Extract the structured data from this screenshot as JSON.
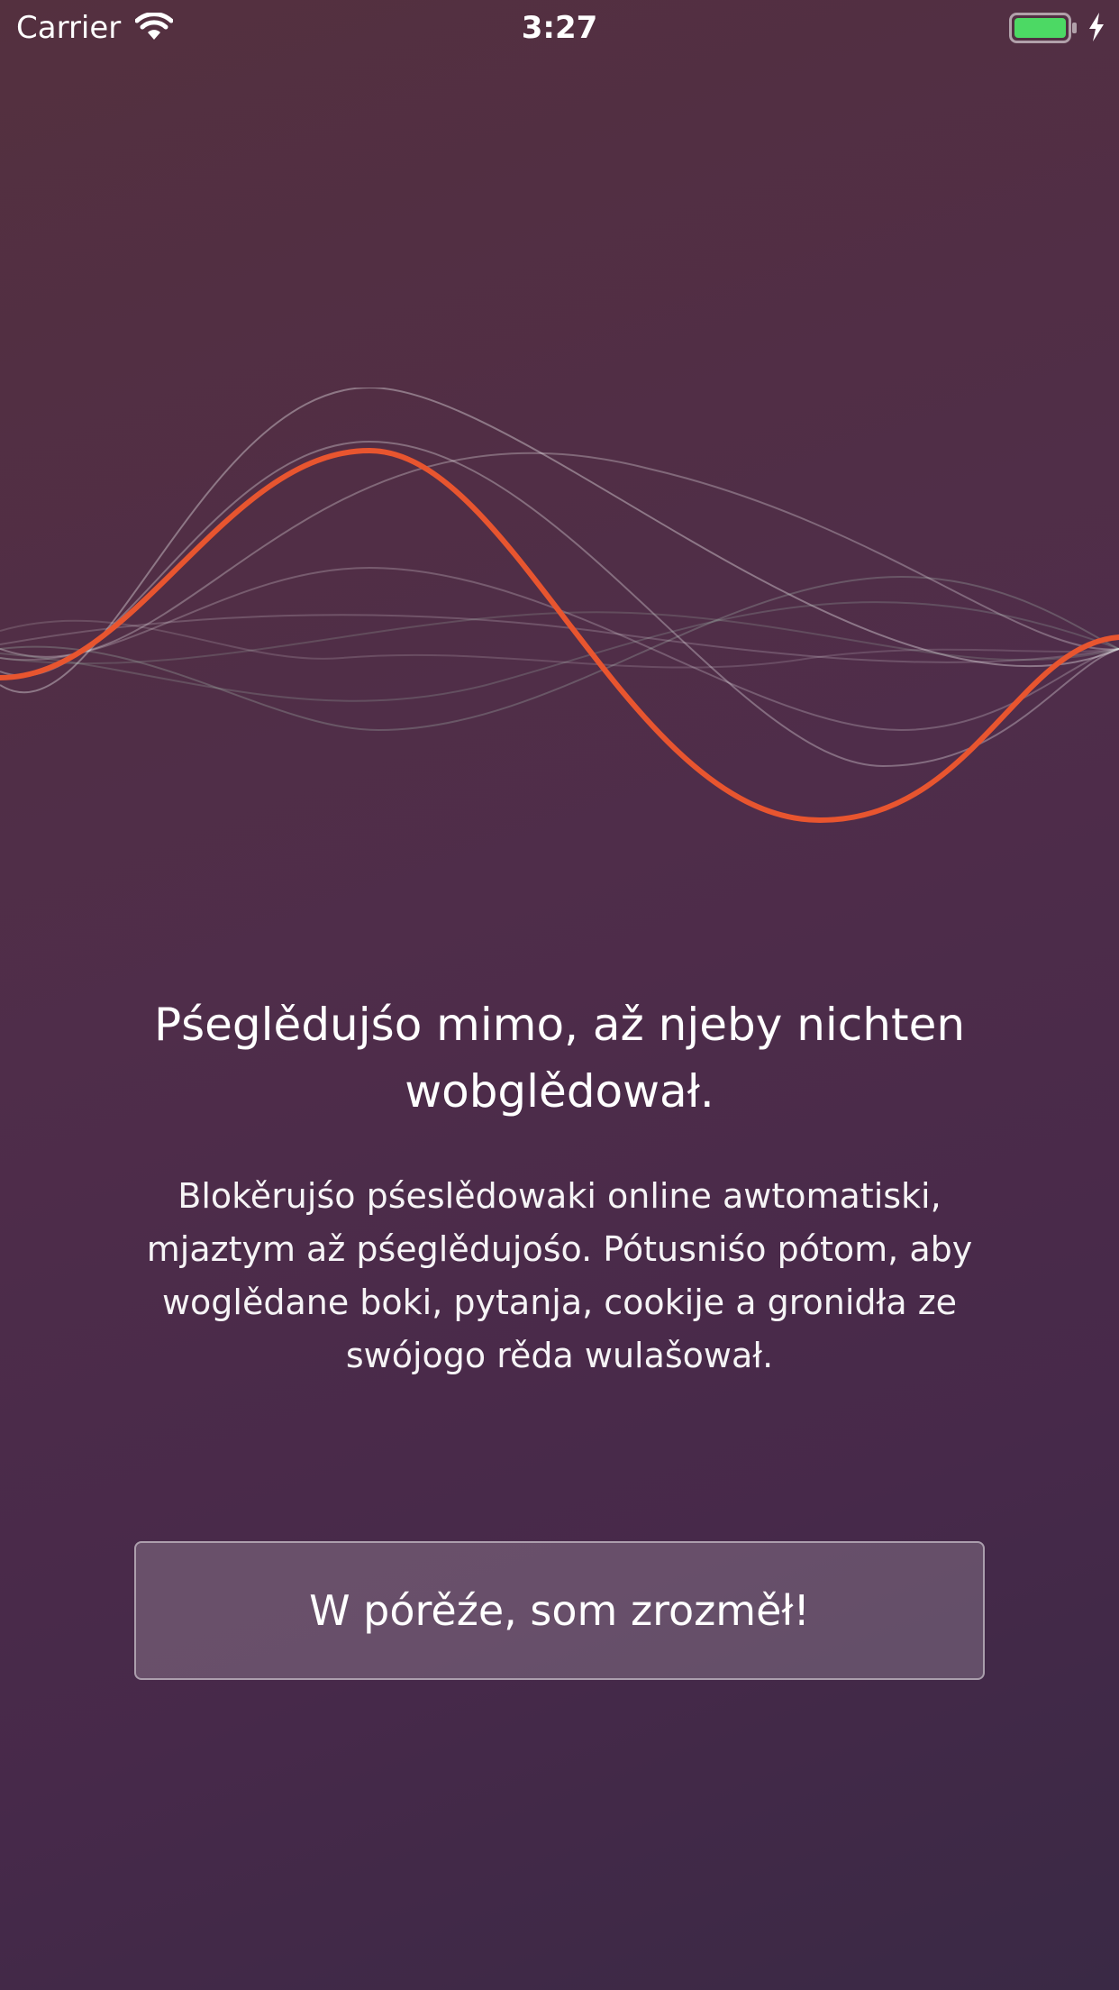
{
  "status_bar": {
    "carrier": "Carrier",
    "time": "3:27",
    "battery_color": "#4cd964",
    "icons": [
      "wifi-icon",
      "battery-icon",
      "charging-bolt-icon"
    ]
  },
  "illustration": {
    "icon": "sound-wave-icon",
    "accent_color": "#e8552f"
  },
  "onboarding": {
    "headline": "Pśeglědujśo mimo, až njeby nichten wobglědował.",
    "body": "Blokěrujśo pśeslědowaki online awtomatiski, mjaztym až pśeglědujośo. Pótusniśo pótom, aby woglědane boki, pytanja, cookije a gronidła ze swójogo rěda wulašował.",
    "button_label": "W pórěźe, som zrozměł!"
  }
}
